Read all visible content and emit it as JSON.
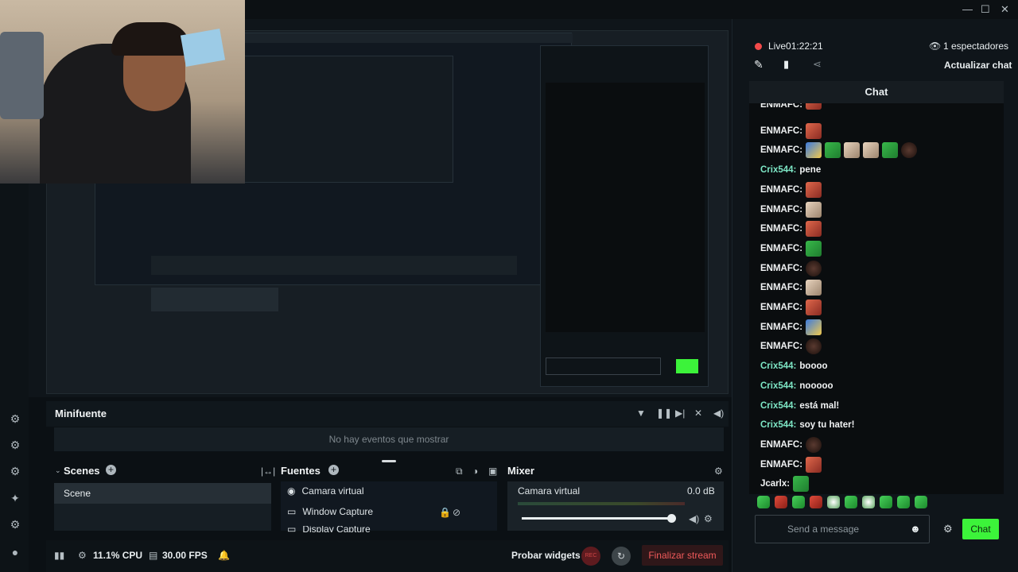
{
  "live": {
    "time": "Live01:22:21",
    "viewers": "1 espectadores",
    "update_chat": "Actualizar chat"
  },
  "chat": {
    "title": "Chat",
    "messages": [
      {
        "user": "ENMAFC:",
        "text": "",
        "emotes": [
          "face"
        ]
      },
      {
        "user": "ENMAFC:",
        "text": "",
        "emotes": [
          "face"
        ]
      },
      {
        "user": "ENMAFC:",
        "text": "",
        "emotes": [
          "blue",
          "frog",
          "cat",
          "cat",
          "frog",
          "dark"
        ]
      },
      {
        "user": "Crix544:",
        "text": "pene",
        "emotes": []
      },
      {
        "user": "ENMAFC:",
        "text": "",
        "emotes": [
          "face"
        ]
      },
      {
        "user": "ENMAFC:",
        "text": "",
        "emotes": [
          "cat"
        ]
      },
      {
        "user": "ENMAFC:",
        "text": "",
        "emotes": [
          "face"
        ]
      },
      {
        "user": "ENMAFC:",
        "text": "",
        "emotes": [
          "frog"
        ]
      },
      {
        "user": "ENMAFC:",
        "text": "",
        "emotes": [
          "dark"
        ]
      },
      {
        "user": "ENMAFC:",
        "text": "",
        "emotes": [
          "cat"
        ]
      },
      {
        "user": "ENMAFC:",
        "text": "",
        "emotes": [
          "face"
        ]
      },
      {
        "user": "ENMAFC:",
        "text": "",
        "emotes": [
          "blue"
        ]
      },
      {
        "user": "ENMAFC:",
        "text": "",
        "emotes": [
          "dark"
        ]
      },
      {
        "user": "Crix544:",
        "text": "boooo",
        "emotes": []
      },
      {
        "user": "Crix544:",
        "text": "nooooo",
        "emotes": []
      },
      {
        "user": "Crix544:",
        "text": "está mal!",
        "emotes": []
      },
      {
        "user": "Crix544:",
        "text": "soy tu hater!",
        "emotes": []
      },
      {
        "user": "ENMAFC:",
        "text": "",
        "emotes": [
          "dark"
        ]
      },
      {
        "user": "ENMAFC:",
        "text": "",
        "emotes": [
          "face"
        ]
      },
      {
        "user": "Jcarlx:",
        "text": "",
        "emotes": [
          "frog"
        ]
      }
    ],
    "placeholder": "Send a message",
    "send": "Chat"
  },
  "minifuente": {
    "title": "Minifuente",
    "empty": "No hay eventos que mostrar"
  },
  "scenes": {
    "title": "Scenes",
    "items": [
      "Scene"
    ]
  },
  "sources": {
    "title": "Fuentes",
    "items": [
      "Camara virtual",
      "Window Capture",
      "Display Capture"
    ]
  },
  "mixer": {
    "title": "Mixer",
    "channel": "Camara virtual",
    "db": "0.0 dB"
  },
  "status": {
    "cpu": "11.1% CPU",
    "fps": "30.00 FPS",
    "probar": "Probar widgets",
    "rec": "REC",
    "end": "Finalizar stream"
  }
}
